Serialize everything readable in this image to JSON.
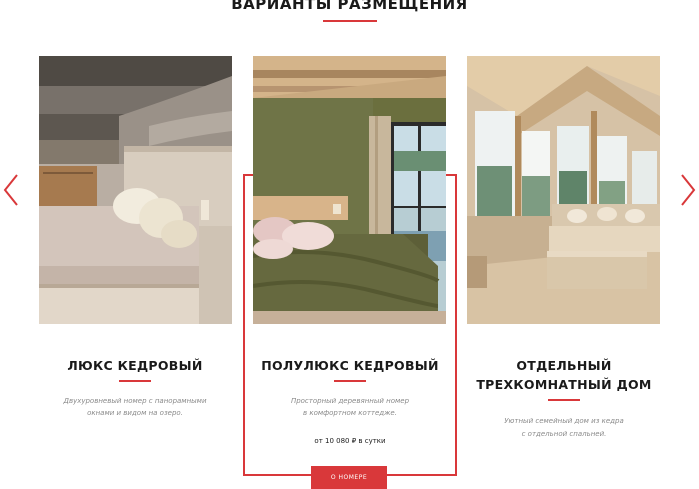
{
  "section": {
    "title": "ВАРИАНТЫ РАЗМЕЩЕНИЯ"
  },
  "nav": {
    "prev_icon": "chevron-left-icon",
    "next_icon": "chevron-right-icon"
  },
  "colors": {
    "accent": "#d9383a",
    "text": "#1a1a1a",
    "muted": "#8a8a8a"
  },
  "cards": [
    {
      "title": "ЛЮКС КЕДРОВЫЙ",
      "desc_line1": "Двухуровневый номер с панорамными",
      "desc_line2": "окнами и видом на озеро.",
      "image": "bedroom-log-cabin-photo"
    },
    {
      "title": "ПОЛУЛЮКС КЕДРОВЫЙ",
      "desc_line1": "Просторный деревянный номер",
      "desc_line2": "в комфортном коттедже.",
      "price": "от 10 080 ₽ в сутки",
      "button_label": "О НОМЕРЕ",
      "image": "bedroom-green-wall-photo",
      "active": true
    },
    {
      "title_line1": "ОТДЕЛЬНЫЙ",
      "title_line2": "ТРЕХКОМНАТНЫЙ ДОМ",
      "desc_line1": "Уютный семейный дом из кедра",
      "desc_line2": "с отдельной спальней.",
      "image": "living-room-photo"
    }
  ]
}
